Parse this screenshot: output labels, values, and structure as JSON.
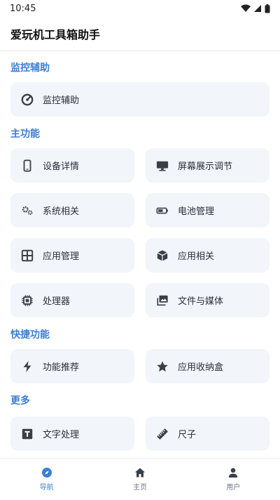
{
  "status_bar": {
    "time": "10:45"
  },
  "app_bar": {
    "title": "爱玩机工具箱助手"
  },
  "sections": {
    "monitor": {
      "title": "监控辅助",
      "items": [
        {
          "label": "监控辅助",
          "icon": "speedometer-icon"
        }
      ]
    },
    "main": {
      "title": "主功能",
      "items": [
        {
          "label": "设备详情",
          "icon": "phone-icon"
        },
        {
          "label": "屏幕展示调节",
          "icon": "monitor-icon"
        },
        {
          "label": "系统相关",
          "icon": "gears-icon"
        },
        {
          "label": "电池管理",
          "icon": "battery-icon"
        },
        {
          "label": "应用管理",
          "icon": "grid-icon"
        },
        {
          "label": "应用相关",
          "icon": "cube-icon"
        },
        {
          "label": "处理器",
          "icon": "chip-icon"
        },
        {
          "label": "文件与媒体",
          "icon": "images-icon"
        }
      ]
    },
    "quick": {
      "title": "快捷功能",
      "items": [
        {
          "label": "功能推荐",
          "icon": "bolt-icon"
        },
        {
          "label": "应用收纳盒",
          "icon": "star-icon"
        }
      ]
    },
    "more": {
      "title": "更多",
      "items": [
        {
          "label": "文字处理",
          "icon": "text-icon"
        },
        {
          "label": "尺子",
          "icon": "ruler-icon"
        }
      ]
    }
  },
  "bottom_nav": {
    "items": [
      {
        "label": "导航",
        "icon": "compass-icon",
        "active": true
      },
      {
        "label": "主页",
        "icon": "home-icon",
        "active": false
      },
      {
        "label": "用户",
        "icon": "user-icon",
        "active": false
      }
    ]
  },
  "colors": {
    "accent": "#3b7fd4",
    "card_bg": "#f2f5fa",
    "icon": "#3a3f47"
  }
}
